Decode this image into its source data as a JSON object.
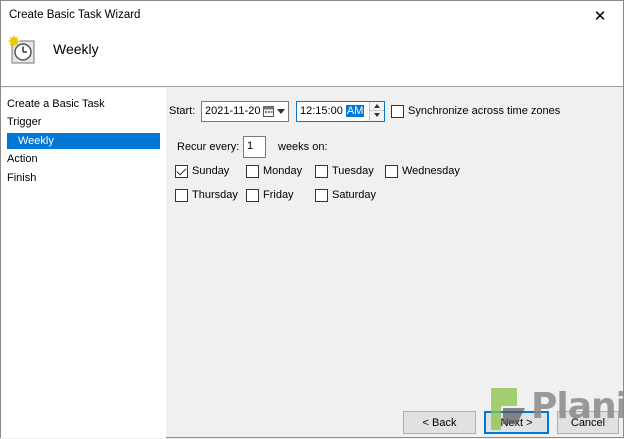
{
  "window": {
    "title": "Create Basic Task Wizard",
    "close_glyph": "✕"
  },
  "header": {
    "title": "Weekly",
    "icon": "task-clock-icon"
  },
  "nav": {
    "items": [
      {
        "label": "Create a Basic Task",
        "selected": false
      },
      {
        "label": "Trigger",
        "selected": false
      },
      {
        "label": "Weekly",
        "selected": true
      },
      {
        "label": "Action",
        "selected": false
      },
      {
        "label": "Finish",
        "selected": false
      }
    ]
  },
  "form": {
    "start_label": "Start:",
    "start_date": "2021-11-20",
    "start_time": "12:15:00",
    "start_ampm": "AM",
    "sync_label": "Synchronize across time zones",
    "sync_checked": false,
    "recur_label": "Recur every:",
    "recur_value": "1",
    "weeks_label": "weeks on:",
    "days": [
      {
        "label": "Sunday",
        "checked": true
      },
      {
        "label": "Monday",
        "checked": false
      },
      {
        "label": "Tuesday",
        "checked": false
      },
      {
        "label": "Wednesday",
        "checked": false
      },
      {
        "label": "Thursday",
        "checked": false
      },
      {
        "label": "Friday",
        "checked": false
      },
      {
        "label": "Saturday",
        "checked": false
      }
    ]
  },
  "buttons": {
    "back": "< Back",
    "next": "Next >",
    "cancel": "Cancel"
  },
  "watermark": {
    "text": "Planit"
  },
  "colors": {
    "accent": "#0078d7",
    "watermark_green": "#8bc34a"
  }
}
